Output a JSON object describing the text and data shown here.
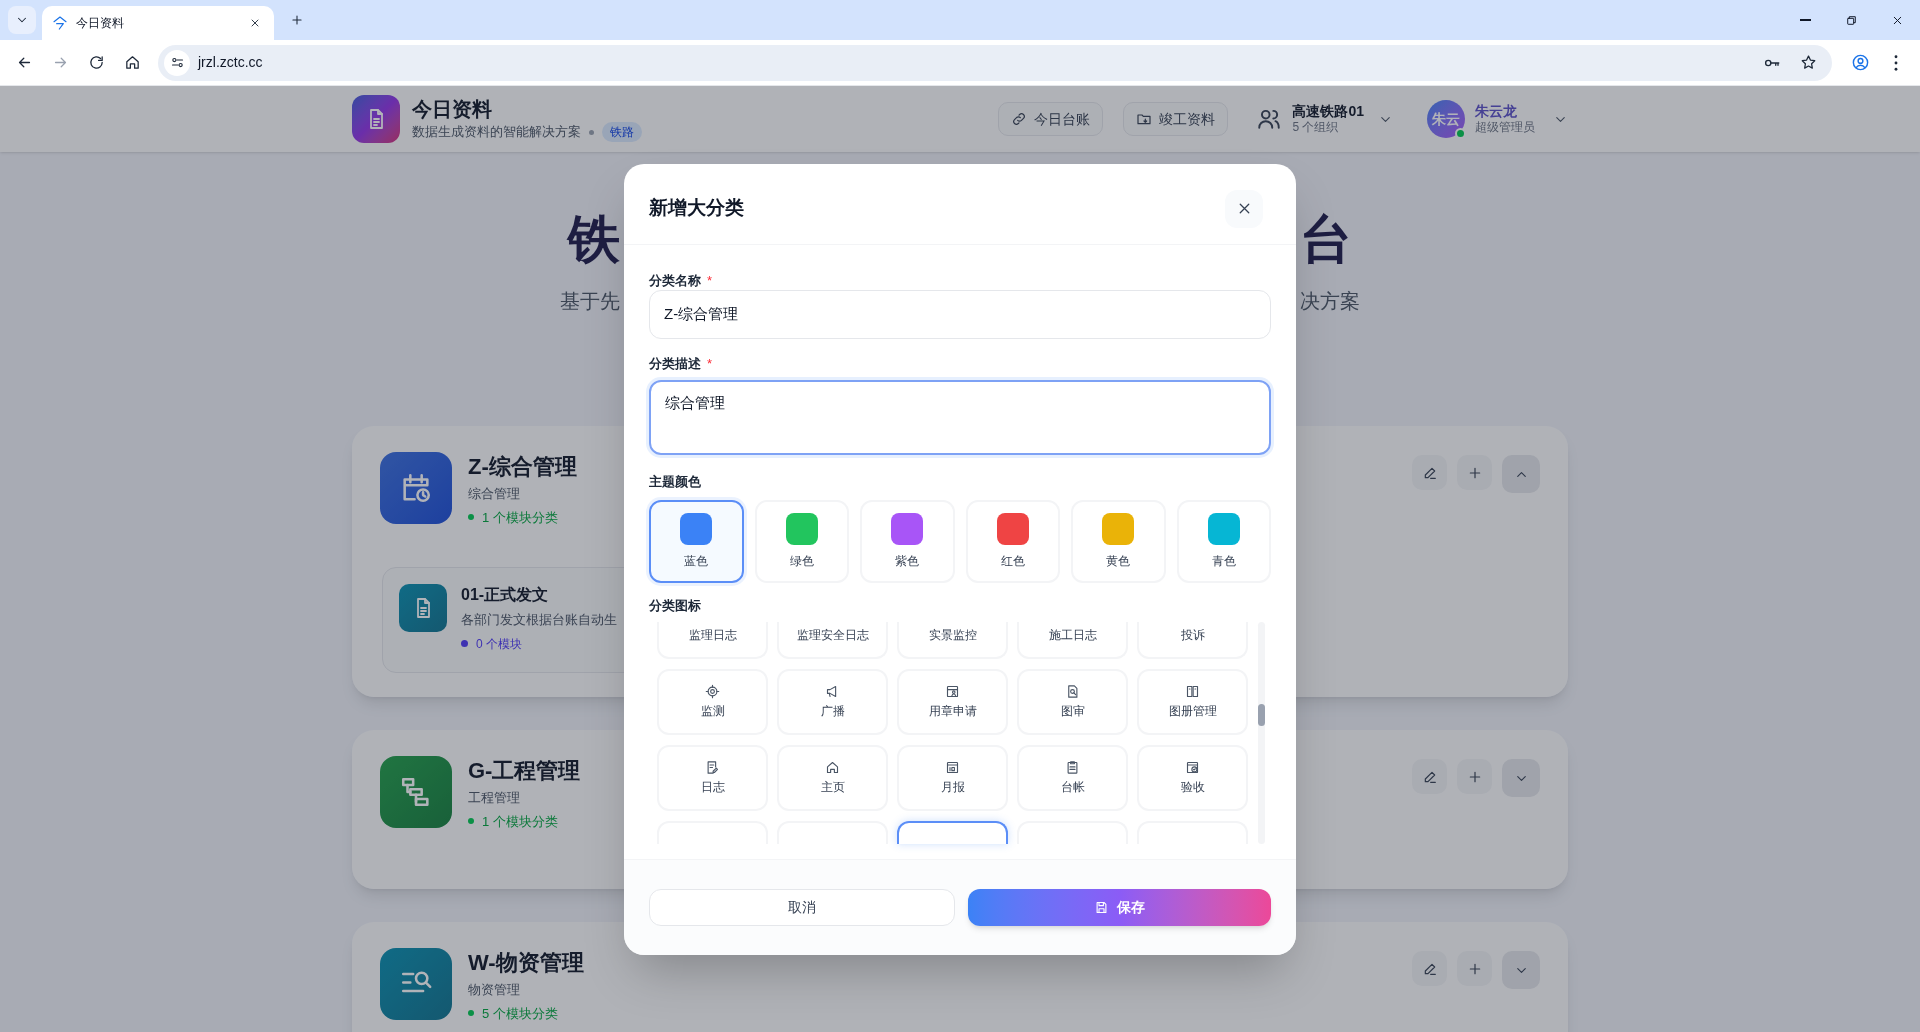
{
  "browser": {
    "tab": {
      "title": "今日资料"
    },
    "url": "jrzl.zctc.cc"
  },
  "header": {
    "app_name": "今日资料",
    "tagline": "数据生成资料的智能解决方案",
    "tag": "铁路",
    "nav": [
      {
        "label": "今日台账"
      },
      {
        "label": "竣工资料"
      }
    ],
    "org": {
      "name": "高速铁路01",
      "count": "5 个组织"
    },
    "user": {
      "avatar": "朱云",
      "name": "朱云龙",
      "role": "超级管理员",
      "online": true
    }
  },
  "hero": {
    "title_left": "铁",
    "title_right": "台",
    "subtitle_left": "基于先",
    "subtitle_right": "决方案"
  },
  "categories": [
    {
      "title": "Z-综合管理",
      "description": "综合管理",
      "count": "1 个模块分类",
      "expanded": true,
      "children": [
        {
          "title": "01-正式发文",
          "description": "各部门发文根据台账自动生",
          "count": "0 个模块"
        }
      ]
    },
    {
      "title": "G-工程管理",
      "description": "工程管理",
      "count": "1 个模块分类",
      "expanded": false
    },
    {
      "title": "W-物资管理",
      "description": "物资管理",
      "count": "5 个模块分类",
      "expanded": false
    }
  ],
  "dialog": {
    "title": "新增大分类",
    "fields": [
      {
        "kind": "input",
        "label": "分类名称",
        "required_mark": "*",
        "value": "Z-综合管理",
        "focused": false
      },
      {
        "kind": "textarea",
        "label": "分类描述",
        "required_mark": "*",
        "value": "综合管理",
        "focused": true
      }
    ],
    "theme_colors": {
      "label": "主题颜色",
      "options": [
        {
          "label": "蓝色",
          "color": "#3b82f6",
          "selected": true
        },
        {
          "label": "绿色",
          "color": "#22c55e",
          "selected": false
        },
        {
          "label": "紫色",
          "color": "#a855f7",
          "selected": false
        },
        {
          "label": "红色",
          "color": "#ef4444",
          "selected": false
        },
        {
          "label": "黄色",
          "color": "#eab308",
          "selected": false
        },
        {
          "label": "青色",
          "color": "#06b6d4",
          "selected": false
        }
      ]
    },
    "icons": {
      "label": "分类图标",
      "items": [
        {
          "kind": "label",
          "label": "监理日志",
          "selected": false
        },
        {
          "kind": "label",
          "label": "监理安全日志",
          "selected": false
        },
        {
          "kind": "label",
          "label": "实景监控",
          "selected": false
        },
        {
          "kind": "label",
          "label": "施工日志",
          "selected": false
        },
        {
          "kind": "label",
          "label": "投诉",
          "selected": false
        },
        {
          "kind": "full",
          "label": "监测",
          "selected": false
        },
        {
          "kind": "full",
          "label": "广播",
          "selected": false
        },
        {
          "kind": "full",
          "label": "用章申请",
          "selected": false
        },
        {
          "kind": "full",
          "label": "图审",
          "selected": false
        },
        {
          "kind": "full",
          "label": "图册管理",
          "selected": false
        },
        {
          "kind": "full",
          "label": "日志",
          "selected": false
        },
        {
          "kind": "full",
          "label": "主页",
          "selected": false
        },
        {
          "kind": "full",
          "label": "月报",
          "selected": false
        },
        {
          "kind": "full",
          "label": "台帐",
          "selected": false
        },
        {
          "kind": "full",
          "label": "验收",
          "selected": false
        },
        {
          "kind": "edge",
          "selected": false
        },
        {
          "kind": "edge",
          "selected": false
        },
        {
          "kind": "edge",
          "selected": true
        },
        {
          "kind": "edge",
          "selected": false
        },
        {
          "kind": "edge",
          "selected": false
        }
      ]
    },
    "buttons": {
      "cancel": "取消",
      "save": "保存"
    }
  }
}
